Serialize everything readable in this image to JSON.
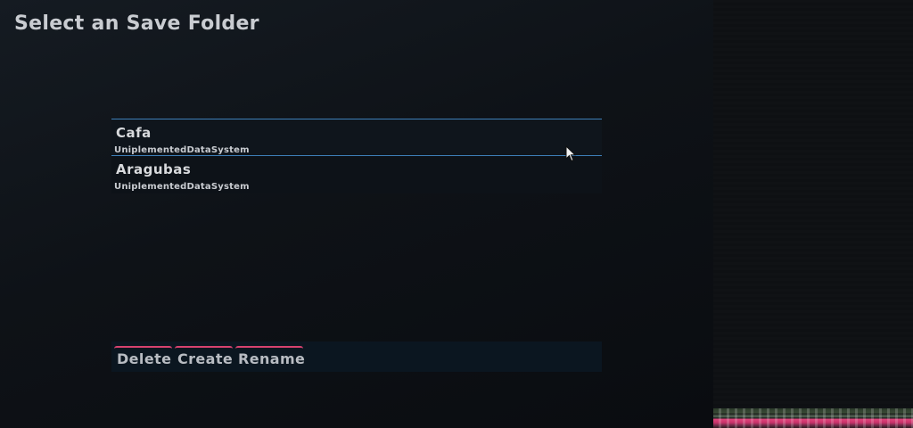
{
  "page": {
    "title": "Select an Save Folder"
  },
  "folders": [
    {
      "name": "Cafa",
      "subtitle": "UniplementedDataSystem",
      "selected": true
    },
    {
      "name": "Aragubas",
      "subtitle": "UniplementedDataSystem",
      "selected": false
    }
  ],
  "buttons": {
    "delete": "Delete",
    "create": "Create",
    "rename": "Rename"
  },
  "colors": {
    "selection_border": "#3d7fb8",
    "button_accent": "#d6426f",
    "background": "#0a0c10"
  },
  "icons": {
    "cursor": "mouse-pointer-icon"
  }
}
